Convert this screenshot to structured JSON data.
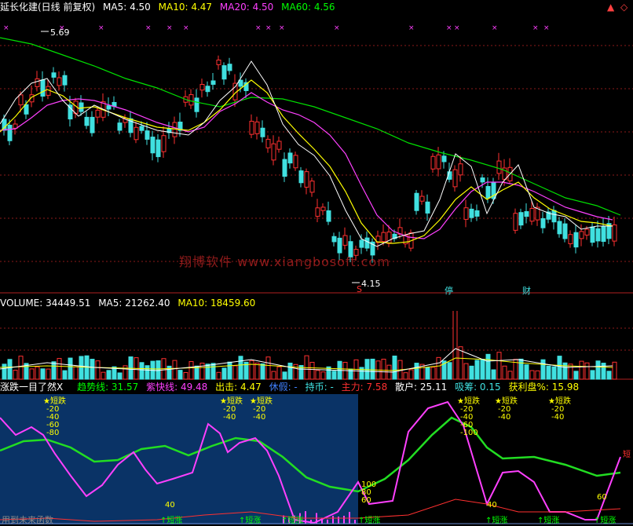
{
  "header": {
    "title": "延长化建(日线 前复权)",
    "ma5": "MA5: 4.50",
    "ma10": "MA10: 4.47",
    "ma20": "MA20: 4.50",
    "ma60": "MA60: 4.56"
  },
  "price_annotations": {
    "high": "5.69",
    "low": "4.15",
    "markers": [
      "S",
      "停",
      "财"
    ]
  },
  "watermark": "翔博软件 www.xiangbosoft.com",
  "volume_header": {
    "volume": "VOLUME: 34449.51",
    "ma5": "MA5: 21262.40",
    "ma10": "MA10: 18459.60"
  },
  "indicator_header": {
    "name": "涨跌一目了然X",
    "trend": "趋势线: 31.57",
    "purple": "紫快线: 49.48",
    "attack": "出击: 4.47",
    "rest": "休假: -",
    "hold": "持币: -",
    "main": "主力: 7.58",
    "retail": "散户: 25.11",
    "absorb": "吸筹: 0.15",
    "profit": "获利盘%: 15.98"
  },
  "indicator_labels": {
    "short_fall": "短跌",
    "short_rise": "短涨",
    "fall_levels": [
      "-20",
      "-40",
      "-60",
      "-80",
      "-100"
    ],
    "rise_levels": [
      "40",
      "60",
      "80",
      "100"
    ],
    "right_edge": "短"
  },
  "bottom": "用到未来函数",
  "colors": {
    "ma5": "#ffffff",
    "ma10": "#ffff00",
    "ma20": "#ff40ff",
    "ma60": "#00ff00",
    "up": "#ff3030",
    "down": "#40e0e0",
    "panel_bg": "#0a3366"
  }
}
